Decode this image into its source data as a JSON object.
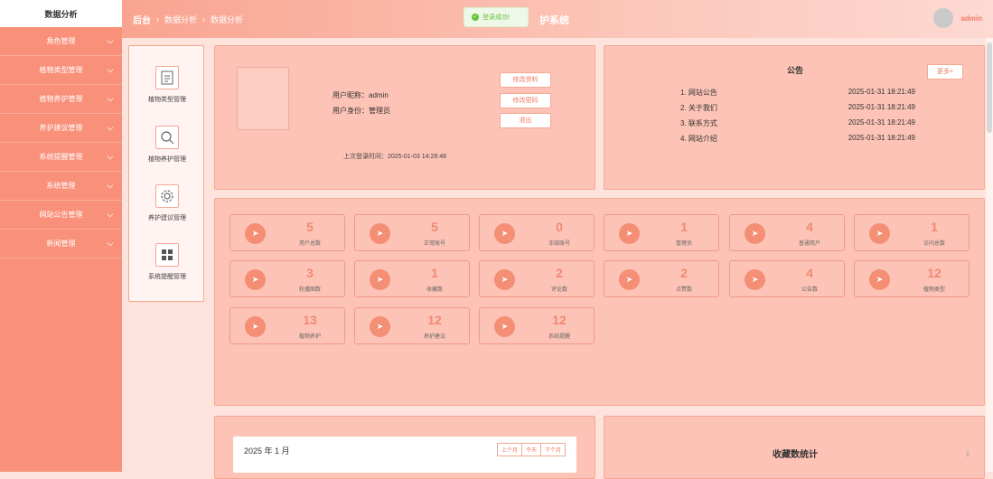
{
  "sidebar": {
    "active": "数据分析",
    "items": [
      "角色管理",
      "植物类型管理",
      "植物养护管理",
      "养护建议管理",
      "系统提醒管理",
      "系统管理",
      "网站公告管理",
      "新闻管理"
    ]
  },
  "header": {
    "breadcrumb": [
      "后台",
      "数据分析",
      "数据分析"
    ],
    "title_fragment": "护系统",
    "user": "admin"
  },
  "toast": {
    "message": "登录成功!"
  },
  "quick_links": [
    "植物类型管理",
    "植物养护管理",
    "养护建议管理",
    "系统提醒管理"
  ],
  "profile": {
    "nickname_label": "用户昵称：",
    "nickname": "admin",
    "role_label": "用户身份：",
    "role": "管理员",
    "last_login": "上次登录时间：2025-01-03 14:28:48",
    "buttons": [
      "修改资料",
      "修改密码",
      "退出"
    ]
  },
  "notice": {
    "title": "公告",
    "more": "更多+",
    "items": [
      {
        "label": "1. 网站公告",
        "date": "2025-01-31 18:21:49"
      },
      {
        "label": "2. 关于我们",
        "date": "2025-01-31 18:21:49"
      },
      {
        "label": "3. 联系方式",
        "date": "2025-01-31 18:21:49"
      },
      {
        "label": "4. 网站介绍",
        "date": "2025-01-31 18:21:49"
      }
    ]
  },
  "stats": [
    {
      "value": "5",
      "label": "用户总数"
    },
    {
      "value": "5",
      "label": "正常账号"
    },
    {
      "value": "0",
      "label": "冻结账号"
    },
    {
      "value": "1",
      "label": "管理员"
    },
    {
      "value": "4",
      "label": "普通用户"
    },
    {
      "value": "1",
      "label": "访问总数"
    },
    {
      "value": "3",
      "label": "轮播图数"
    },
    {
      "value": "1",
      "label": "收藏数"
    },
    {
      "value": "2",
      "label": "评论数"
    },
    {
      "value": "2",
      "label": "点赞数"
    },
    {
      "value": "4",
      "label": "公告数"
    },
    {
      "value": "12",
      "label": "植物类型"
    },
    {
      "value": "13",
      "label": "植物养护"
    },
    {
      "value": "12",
      "label": "养护建议"
    },
    {
      "value": "12",
      "label": "系统提醒"
    }
  ],
  "calendar": {
    "month": "2025 年 1 月",
    "nav": [
      "上个月",
      "今天",
      "下个月"
    ]
  },
  "favorites": {
    "title": "收藏数统计"
  },
  "colors": {
    "accent": "#f9917a",
    "number": "#f08a72"
  }
}
